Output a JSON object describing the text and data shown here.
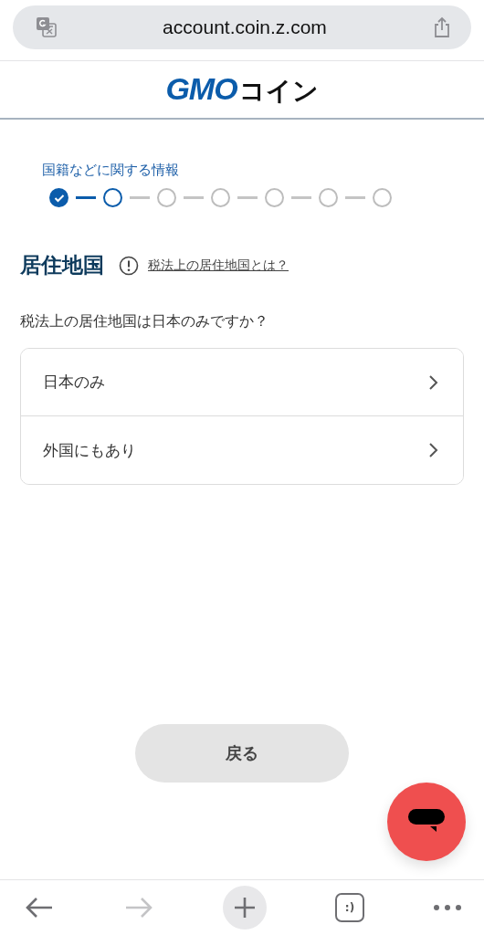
{
  "browser": {
    "url": "account.coin.z.com",
    "back_disabled": false,
    "forward_disabled": true,
    "tabs_label": ":)"
  },
  "logo": {
    "latin": "GMO",
    "kana": "コイン"
  },
  "progress": {
    "label": "国籍などに関する情報",
    "steps": [
      {
        "kind": "done"
      },
      {
        "kind": "current"
      },
      {
        "kind": "todo"
      },
      {
        "kind": "todo"
      },
      {
        "kind": "todo"
      },
      {
        "kind": "todo"
      },
      {
        "kind": "todo"
      }
    ]
  },
  "section": {
    "title": "居住地国",
    "help_link": "税法上の居住地国とは？"
  },
  "question": "税法上の居住地国は日本のみですか？",
  "options": [
    {
      "label": "日本のみ"
    },
    {
      "label": "外国にもあり"
    }
  ],
  "back_button": "戻る"
}
